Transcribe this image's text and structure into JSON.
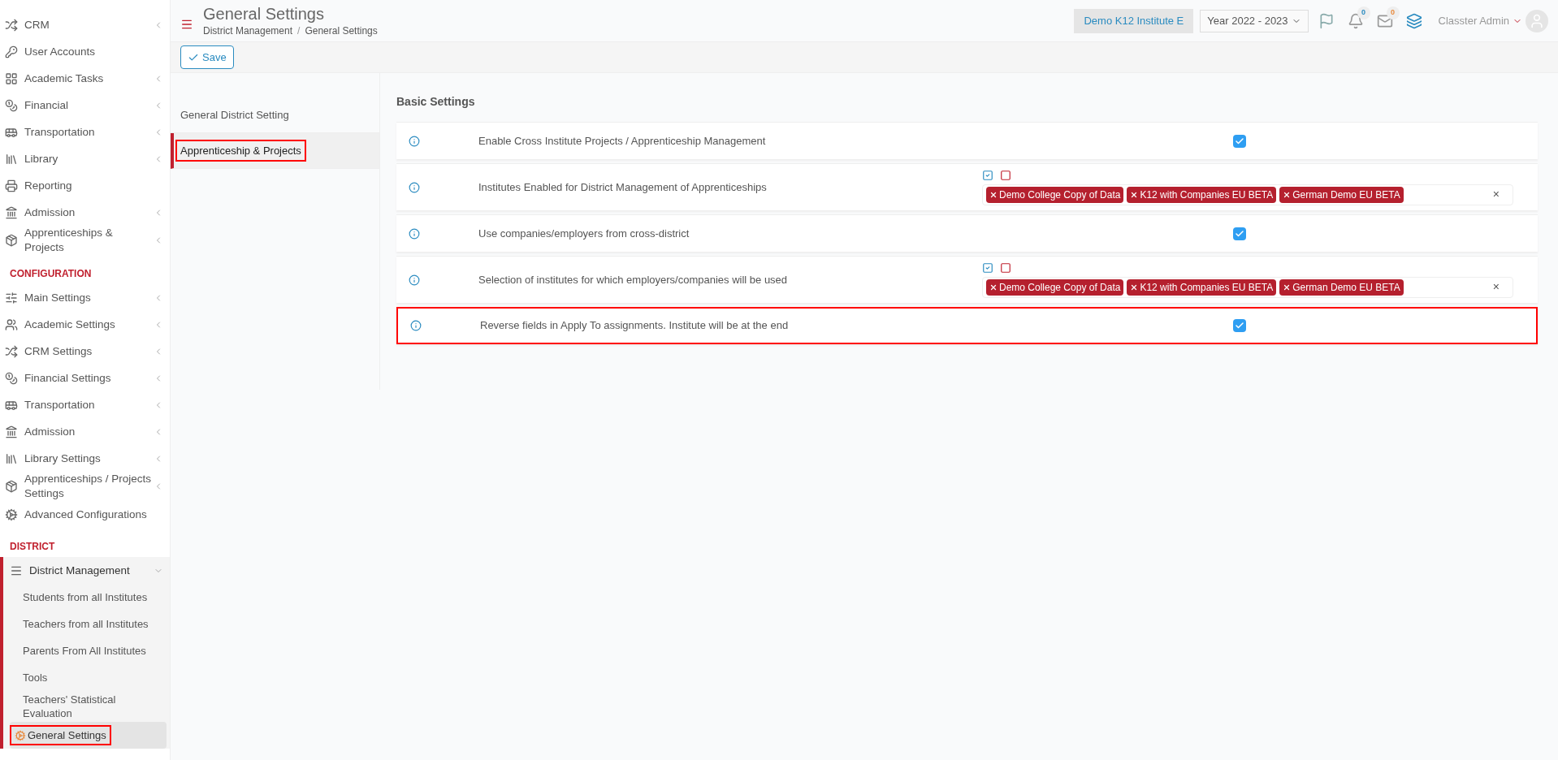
{
  "sidebar": {
    "sections": [
      {
        "items": [
          {
            "label": "CRM",
            "caret": true
          },
          {
            "label": "User Accounts",
            "caret": false
          },
          {
            "label": "Academic Tasks",
            "caret": true
          },
          {
            "label": "Financial",
            "caret": true
          },
          {
            "label": "Transportation",
            "caret": true
          },
          {
            "label": "Library",
            "caret": true
          },
          {
            "label": "Reporting",
            "caret": false
          },
          {
            "label": "Admission",
            "caret": true
          },
          {
            "label": "Apprenticeships & Projects",
            "caret": true
          }
        ]
      },
      {
        "heading": "CONFIGURATION",
        "items": [
          {
            "label": "Main Settings",
            "caret": true
          },
          {
            "label": "Academic Settings",
            "caret": true
          },
          {
            "label": "CRM Settings",
            "caret": true
          },
          {
            "label": "Financial Settings",
            "caret": true
          },
          {
            "label": "Transportation",
            "caret": true
          },
          {
            "label": "Admission",
            "caret": true
          },
          {
            "label": "Library Settings",
            "caret": true
          },
          {
            "label": "Apprenticeships / Projects Settings",
            "caret": true
          },
          {
            "label": "Advanced Configurations",
            "caret": false
          }
        ]
      },
      {
        "heading": "DISTRICT",
        "items": [
          {
            "label": "District Management",
            "caret": true,
            "expanded": true,
            "children": [
              {
                "label": "Students from all Institutes",
                "selected": false,
                "highlighted": false
              },
              {
                "label": "Teachers from all Institutes",
                "selected": false,
                "highlighted": false
              },
              {
                "label": "Parents From All Institutes",
                "selected": false,
                "highlighted": false
              },
              {
                "label": "Tools",
                "selected": false,
                "highlighted": false
              },
              {
                "label": "Teachers' Statistical Evaluation",
                "selected": false,
                "highlighted": false
              },
              {
                "label": "General Settings",
                "selected": true,
                "highlighted": true
              }
            ]
          }
        ]
      }
    ]
  },
  "header": {
    "title": "General Settings",
    "breadcrumb": [
      "District Management",
      "General Settings"
    ],
    "breadcrumb_separator": "/",
    "institute": "Demo K12 Institute E",
    "year": "Year 2022 - 2023",
    "notifications": "0",
    "messages": "0",
    "user": "Classter Admin"
  },
  "toolbar": {
    "save": "Save"
  },
  "tabs": [
    {
      "label": "General District Setting",
      "selected": false,
      "highlighted": false
    },
    {
      "label": "Apprenticeship & Projects",
      "selected": true,
      "highlighted": true
    }
  ],
  "section_title": "Basic Settings",
  "settings": [
    {
      "kind": "checkbox",
      "label": "Enable Cross Institute Projects / Apprenticeship Management",
      "checked": true,
      "highlighted": false
    },
    {
      "kind": "multiselect",
      "label": "Institutes Enabled for District Management of Apprenticeships",
      "tags": [
        "Demo College Copy of Data",
        "K12 with Companies EU BETA",
        "German Demo EU BETA"
      ],
      "clear": "×",
      "highlighted": false
    },
    {
      "kind": "checkbox",
      "label": "Use companies/employers from cross-district",
      "checked": true,
      "highlighted": false
    },
    {
      "kind": "multiselect",
      "label": "Selection of institutes for which employers/companies will be used",
      "tags": [
        "Demo College Copy of Data",
        "K12 with Companies EU BETA",
        "German Demo EU BETA"
      ],
      "clear": "×",
      "highlighted": false
    },
    {
      "kind": "checkbox",
      "label": "Reverse fields in Apply To assignments. Institute will be at the end",
      "checked": true,
      "highlighted": true
    }
  ]
}
